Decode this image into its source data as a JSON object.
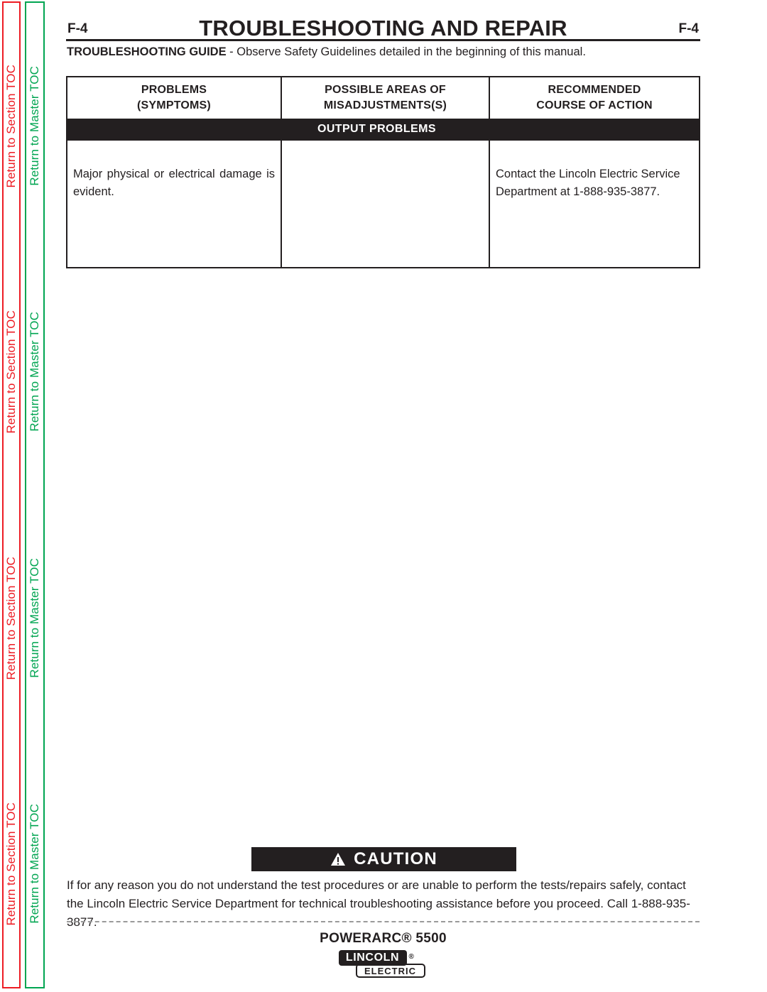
{
  "side_tabs": {
    "section_toc_label": "Return to Section TOC",
    "master_toc_label": "Return to Master TOC",
    "section_color": "#ED1C24",
    "master_color": "#00A551",
    "repeat_count": 4
  },
  "header": {
    "page_number_left": "F-4",
    "page_number_right": "F-4",
    "title": "TROUBLESHOOTING AND REPAIR"
  },
  "guide": {
    "lead": "TROUBLESHOOTING GUIDE",
    "rest": " - Observe Safety Guidelines detailed in the beginning of this manual."
  },
  "table": {
    "columns": [
      {
        "line1": "PROBLEMS",
        "line2": "(SYMPTOMS)"
      },
      {
        "line1": "POSSIBLE AREAS OF",
        "line2": "MISADJUSTMENTS(S)"
      },
      {
        "line1": "RECOMMENDED",
        "line2": "COURSE OF ACTION"
      }
    ],
    "section_band": "OUTPUT  PROBLEMS",
    "rows": [
      {
        "symptom": "Major physical or electrical damage is evident.",
        "misadjustments": "",
        "action": "Contact the Lincoln Electric Service Department at 1-888-935-3877."
      }
    ]
  },
  "caution": {
    "icon": "warning-triangle-icon",
    "title": "CAUTION",
    "body": "If for any reason you do not understand the test procedures or are unable to perform the tests/repairs safely, contact the Lincoln Electric Service Department for technical troubleshooting assistance before you proceed. Call 1-888-935-3877."
  },
  "footer": {
    "model": "POWERARC® 5500",
    "brand_top": "LINCOLN",
    "brand_reg": "®",
    "brand_bottom": "ELECTRIC"
  }
}
